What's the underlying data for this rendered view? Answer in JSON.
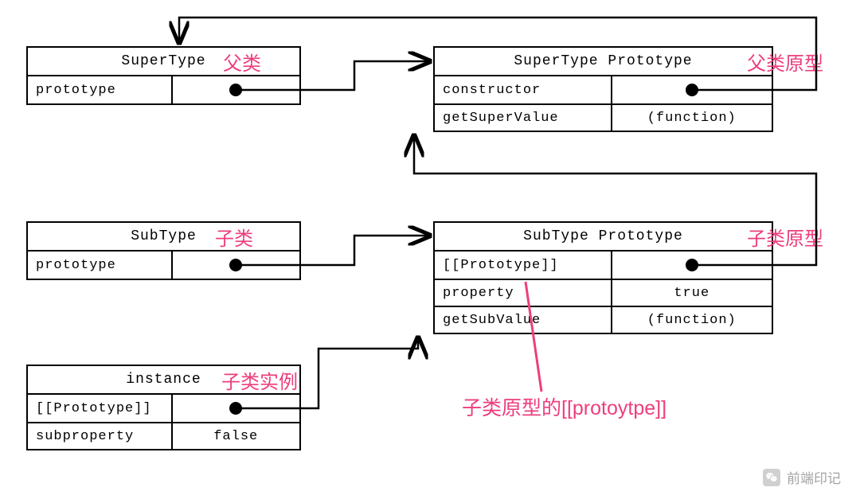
{
  "colors": {
    "annotation": "#ed3e7d",
    "stroke": "#000000"
  },
  "boxes": {
    "superType": {
      "title": "SuperType",
      "label": "父类",
      "rows": [
        {
          "left": "prototype",
          "right_kind": "dot"
        }
      ]
    },
    "superProto": {
      "title": "SuperType Prototype",
      "label": "父类原型",
      "rows": [
        {
          "left": "constructor",
          "right_kind": "dot"
        },
        {
          "left": "getSuperValue",
          "right_text": "(function)"
        }
      ]
    },
    "subType": {
      "title": "SubType",
      "label": "子类",
      "rows": [
        {
          "left": "prototype",
          "right_kind": "dot"
        }
      ]
    },
    "subProto": {
      "title": "SubType Prototype",
      "label": "子类原型",
      "rows": [
        {
          "left": "[[Prototype]]",
          "right_kind": "dot"
        },
        {
          "left": "property",
          "right_text": "true"
        },
        {
          "left": "getSubValue",
          "right_text": "(function)"
        }
      ]
    },
    "instance": {
      "title": "instance",
      "label": "子类实例",
      "rows": [
        {
          "left": "[[Prototype]]",
          "right_kind": "dot"
        },
        {
          "left": "subproperty",
          "right_text": "false"
        }
      ]
    }
  },
  "annotation": {
    "protoNote": "子类原型的[[protoytpe]]"
  },
  "watermark": {
    "text": "前端印记"
  }
}
